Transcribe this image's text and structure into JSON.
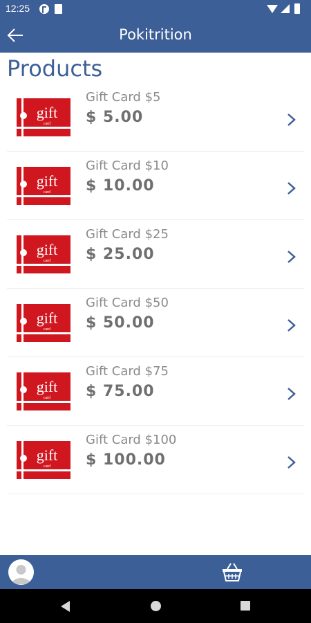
{
  "status_bar": {
    "time": "12:25"
  },
  "app_bar": {
    "title": "Pokitrition",
    "back_icon": "arrow-left-icon"
  },
  "page": {
    "title": "Products"
  },
  "products": [
    {
      "name": "Gift Card $5",
      "price": "$ 5.00",
      "image_text": "gift",
      "image_subtext": "card"
    },
    {
      "name": "Gift Card $10",
      "price": "$ 10.00",
      "image_text": "gift",
      "image_subtext": "card"
    },
    {
      "name": "Gift Card $25",
      "price": "$ 25.00",
      "image_text": "gift",
      "image_subtext": "card"
    },
    {
      "name": "Gift Card $50",
      "price": "$ 50.00",
      "image_text": "gift",
      "image_subtext": "card"
    },
    {
      "name": "Gift Card $75",
      "price": "$ 75.00",
      "image_text": "gift",
      "image_subtext": "card"
    },
    {
      "name": "Gift Card $100",
      "price": "$ 100.00",
      "image_text": "gift",
      "image_subtext": "card"
    }
  ],
  "bottom_bar": {
    "left_icon": "user-avatar-icon",
    "right_icon": "basket-icon"
  },
  "colors": {
    "primary": "#3d5f97",
    "gift_card_red": "#d0161f",
    "text_gray": "#8a8a8a",
    "price_gray": "#6f6f6f"
  }
}
